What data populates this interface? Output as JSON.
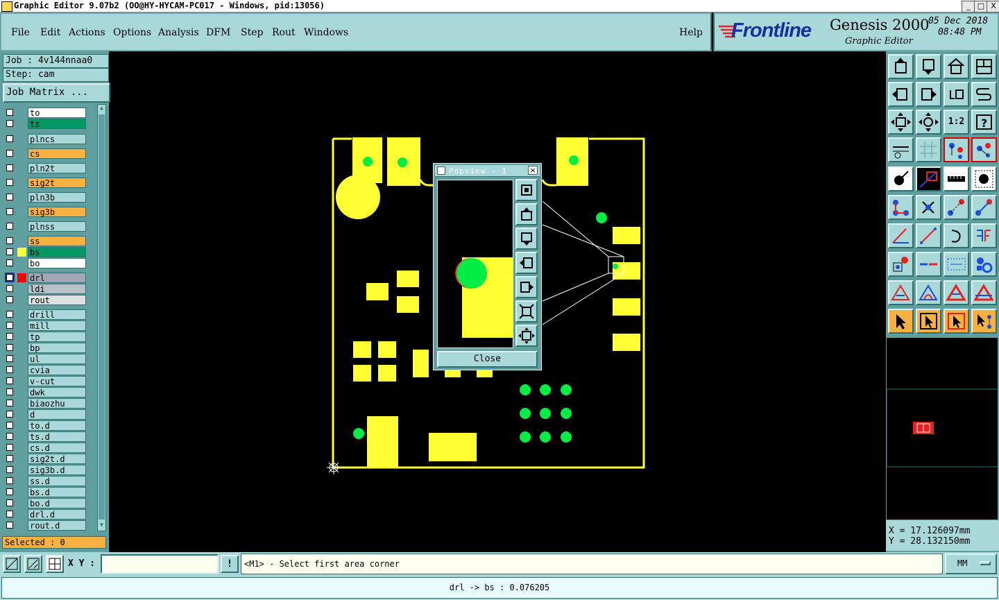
{
  "window": {
    "title": "Graphic Editor 9.07b2  (OO@HY-HYCAM-PC017 - Windows, pid:13056)",
    "minimize": "_",
    "maximize": "□",
    "close": "X"
  },
  "menu": {
    "items": [
      {
        "label": "File"
      },
      {
        "label": "Edit"
      },
      {
        "label": "Actions"
      },
      {
        "label": "Options"
      },
      {
        "label": "Analysis"
      },
      {
        "label": "DFM"
      },
      {
        "label": "Step"
      },
      {
        "label": "Rout"
      },
      {
        "label": "Windows"
      }
    ],
    "help": "Help"
  },
  "brand": {
    "logo_text": "Frontline",
    "product": "Genesis 2000",
    "subtitle": "Graphic Editor",
    "date": "05 Dec 2018",
    "time": "08:48 PM"
  },
  "job": {
    "job_label": "Job : 4v144nnaa0",
    "step_label": "Step: cam",
    "matrix_button": "Job Matrix ..."
  },
  "layers": [
    {
      "name": "to",
      "bg": "#ffffff",
      "indicator": ""
    },
    {
      "name": "ts",
      "bg": "#009966",
      "indicator": ""
    },
    {
      "name": "plncs",
      "bg": "#a8d8d8",
      "indicator": ""
    },
    {
      "name": "cs",
      "bg": "#f8b040",
      "indicator": ""
    },
    {
      "name": "pln2t",
      "bg": "#a8d8d8",
      "indicator": ""
    },
    {
      "name": "sig2t",
      "bg": "#f8b040",
      "indicator": ""
    },
    {
      "name": "pln3b",
      "bg": "#a8d8d8",
      "indicator": ""
    },
    {
      "name": "sig3b",
      "bg": "#f8b040",
      "indicator": ""
    },
    {
      "name": "plnss",
      "bg": "#a8d8d8",
      "indicator": ""
    },
    {
      "name": "ss",
      "bg": "#f8b040",
      "indicator": ""
    },
    {
      "name": "bs",
      "bg": "#009966",
      "indicator": "#ffff33"
    },
    {
      "name": "bo",
      "bg": "#ffffff",
      "indicator": ""
    },
    {
      "name": "drl",
      "bg": "#a0a8b8",
      "indicator": "#ff0000"
    },
    {
      "name": "ldi",
      "bg": "#b8c0c8",
      "indicator": ""
    },
    {
      "name": "rout",
      "bg": "#e0e0e0",
      "indicator": ""
    },
    {
      "name": "drill",
      "bg": "#a8d8d8",
      "indicator": ""
    },
    {
      "name": "mill",
      "bg": "#a8d8d8",
      "indicator": ""
    },
    {
      "name": "tp",
      "bg": "#a8d8d8",
      "indicator": ""
    },
    {
      "name": "bp",
      "bg": "#a8d8d8",
      "indicator": ""
    },
    {
      "name": "ul",
      "bg": "#a8d8d8",
      "indicator": ""
    },
    {
      "name": "cvia",
      "bg": "#a8d8d8",
      "indicator": ""
    },
    {
      "name": "v-cut",
      "bg": "#a8d8d8",
      "indicator": ""
    },
    {
      "name": "dwk",
      "bg": "#a8d8d8",
      "indicator": ""
    },
    {
      "name": "biaozhu",
      "bg": "#a8d8d8",
      "indicator": ""
    },
    {
      "name": "d",
      "bg": "#a8d8d8",
      "indicator": ""
    },
    {
      "name": "to.d",
      "bg": "#a8d8d8",
      "indicator": ""
    },
    {
      "name": "ts.d",
      "bg": "#a8d8d8",
      "indicator": ""
    },
    {
      "name": "cs.d",
      "bg": "#a8d8d8",
      "indicator": ""
    },
    {
      "name": "sig2t.d",
      "bg": "#a8d8d8",
      "indicator": ""
    },
    {
      "name": "sig3b.d",
      "bg": "#a8d8d8",
      "indicator": ""
    },
    {
      "name": "ss.d",
      "bg": "#a8d8d8",
      "indicator": ""
    },
    {
      "name": "bs.d",
      "bg": "#a8d8d8",
      "indicator": ""
    },
    {
      "name": "bo.d",
      "bg": "#a8d8d8",
      "indicator": ""
    },
    {
      "name": "drl.d",
      "bg": "#a8d8d8",
      "indicator": ""
    },
    {
      "name": "rout.d",
      "bg": "#a8d8d8",
      "indicator": ""
    }
  ],
  "selected": "Selected : 0",
  "popview": {
    "title": "Popview - 1",
    "close_button": "Close"
  },
  "toolbar": {
    "zoom_ratio_label": "1:2"
  },
  "coords": {
    "x": "X  = 17.126097mm",
    "y": "Y  = 28.132150mm"
  },
  "command": {
    "xy_label": "X Y :",
    "xy_value": "",
    "prompt": "<M1> - Select first area corner",
    "units": "MM"
  },
  "message": "drl -> bs : 0.076205",
  "colors": {
    "panel": "#a8d8d8",
    "panel_dark": "#5f9f9f",
    "copper": "#ffff33",
    "drill": "#00ee44",
    "selected_layer": "#f8b040"
  }
}
